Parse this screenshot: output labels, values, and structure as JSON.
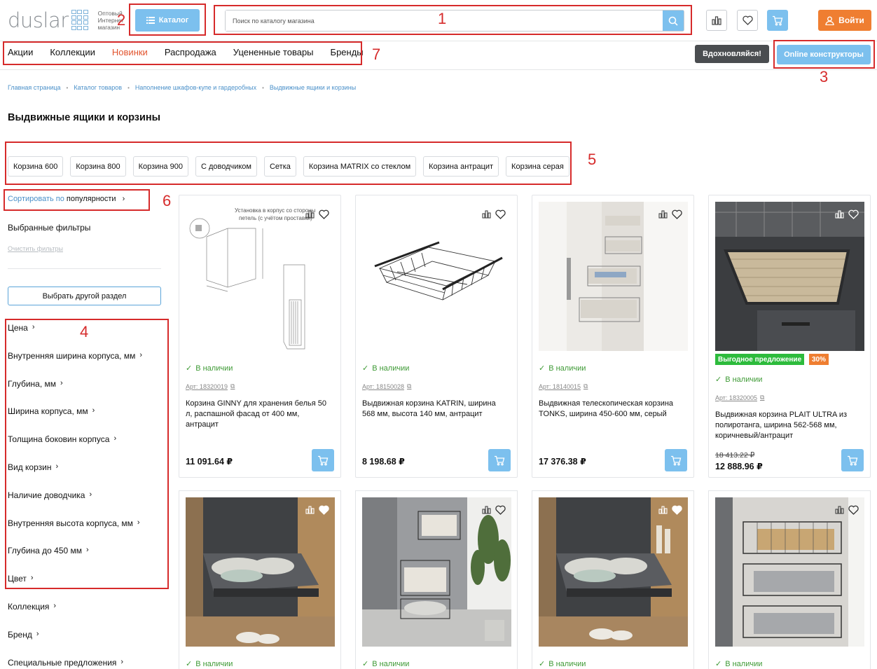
{
  "header": {
    "logo_text": "duslar",
    "logo_tagline": [
      "Оптовый",
      "Интернет",
      "магазин"
    ],
    "catalog_label": "Каталог",
    "search_placeholder": "Поиск по каталогу магазина",
    "login_label": "Войти"
  },
  "nav": {
    "items": [
      "Акции",
      "Коллекции",
      "Новинки",
      "Распродажа",
      "Уцененные товары",
      "Бренды"
    ],
    "inspire_label": "Вдохновляйся!",
    "online_label": "Online конструкторы"
  },
  "breadcrumb": [
    "Главная страница",
    "Каталог товаров",
    "Наполнение шкафов-купе и гардеробных",
    "Выдвижные ящики и корзины"
  ],
  "page_title": "Выдвижные ящики и корзины",
  "chips": [
    "Корзина 600",
    "Корзина 800",
    "Корзина 900",
    "С доводчиком",
    "Сетка",
    "Корзина MATRIX со стеклом",
    "Корзина антрацит",
    "Корзина серая"
  ],
  "sort": {
    "prefix": "Сортировать по",
    "value": "популярности"
  },
  "selected_filters_label": "Выбранные фильтры",
  "clear_filters_label": "Очистить фильтры",
  "other_section_label": "Выбрать другой раздел",
  "filters": [
    "Цена",
    "Внутренняя ширина корпуса, мм",
    "Глубина, мм",
    "Ширина корпуса, мм",
    "Толщина боковин корпуса",
    "Вид корзин",
    "Наличие доводчика",
    "Внутренняя высота корпуса, мм",
    "Глубина до 450 мм",
    "Цвет",
    "Коллекция",
    "Бренд",
    "Специальные предложения"
  ],
  "products": [
    {
      "stock": "В наличии",
      "art": "Арт: 18320019",
      "name": "Корзина GINNY для хранения белья 50 л, распашной фасад от 400 мм, антрацит",
      "price": "11 091.64 ₽",
      "img_caption": "Установка в корпус со стороны петель (с учётом проставки)"
    },
    {
      "stock": "В наличии",
      "art": "Арт: 18150028",
      "name": "Выдвижная корзина KATRIN, ширина 568 мм, высота 140 мм, антрацит",
      "price": "8 198.68 ₽"
    },
    {
      "stock": "В наличии",
      "art": "Арт: 18140015",
      "name": "Выдвижная телескопическая корзина TONKS, ширина 450-600 мм, серый",
      "price": "17 376.38 ₽"
    },
    {
      "stock": "В наличии",
      "art": "Арт: 18320005",
      "name": "Выдвижная корзина PLAIT ULTRA из полиротанга, ширина 562-568 мм, коричневый/антрацит",
      "price": "12 888.96 ₽",
      "old_price": "18 413.22 ₽",
      "badge": "Выгодное предложение",
      "discount": "30%"
    }
  ],
  "products_row2_stock": [
    "В наличии",
    "В наличии",
    "В наличии",
    "В наличии"
  ],
  "annotations": [
    "1",
    "2",
    "3",
    "4",
    "5",
    "6",
    "7"
  ],
  "colors": {
    "accent": "#7cc0ee",
    "orange": "#ef7e31",
    "dark": "#4a4d50",
    "green": "#3e9a35",
    "annotation": "#d62b2b"
  }
}
